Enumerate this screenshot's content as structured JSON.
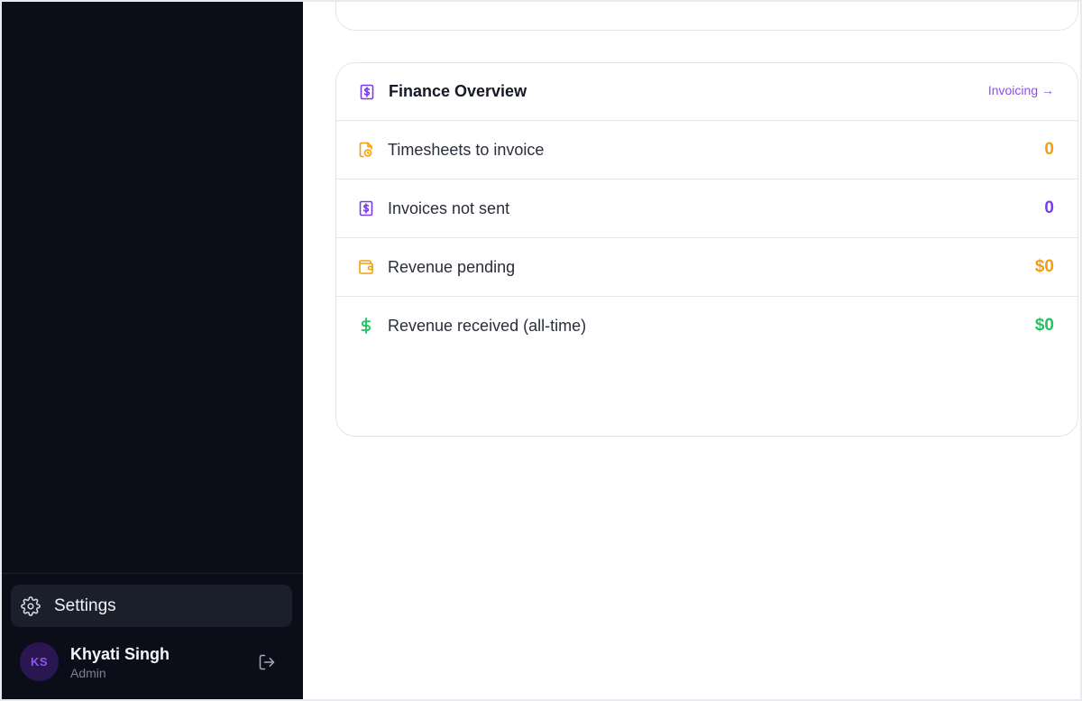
{
  "sidebar": {
    "settings_label": "Settings",
    "user": {
      "initials": "KS",
      "name": "Khyati Singh",
      "role": "Admin"
    }
  },
  "finance": {
    "title": "Finance Overview",
    "link_label": "Invoicing →",
    "rows": [
      {
        "label": "Timesheets to invoice",
        "value": "0",
        "icon": "timesheet-icon",
        "color": "#f59e0b"
      },
      {
        "label": "Invoices not sent",
        "value": "0",
        "icon": "invoice-icon",
        "color": "#7c3aed"
      },
      {
        "label": "Revenue pending",
        "value": "$0",
        "icon": "wallet-icon",
        "color": "#f59e0b"
      },
      {
        "label": "Revenue received (all-time)",
        "value": "$0",
        "icon": "dollar-icon",
        "color": "#22c55e"
      }
    ]
  },
  "colors": {
    "sidebar_bg": "#0b0e19",
    "accent_purple": "#8b4ff0",
    "amber": "#f59e0b",
    "purple": "#7c3aed",
    "green": "#22c55e"
  }
}
